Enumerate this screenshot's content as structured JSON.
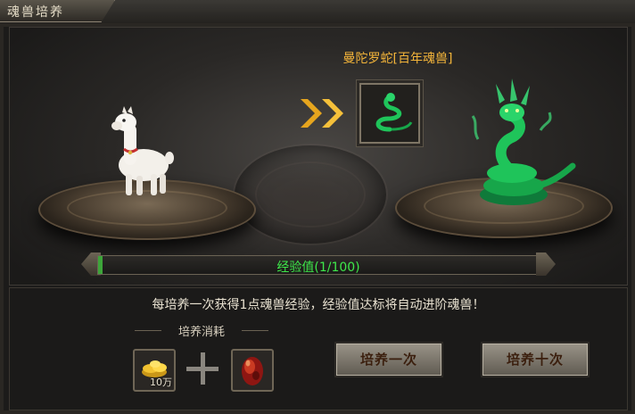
{
  "window": {
    "title": "魂兽培养"
  },
  "target": {
    "name": "曼陀罗蛇[百年魂兽]"
  },
  "experience": {
    "label": "经验值(1/100)",
    "current": 1,
    "max": 100
  },
  "hint": "每培养一次获得1点魂兽经验，经验值达标将自动进阶魂兽！",
  "cost": {
    "title": "培养消耗",
    "items": [
      {
        "icon": "gold-ingot-icon",
        "qty": "10万"
      },
      {
        "icon": "red-egg-icon",
        "qty": ""
      }
    ]
  },
  "buttons": {
    "once": "培养一次",
    "ten": "培养十次"
  },
  "colors": {
    "accent": "#f4b53a",
    "exp_text": "#3ee84a",
    "snake": "#1fc45a"
  }
}
